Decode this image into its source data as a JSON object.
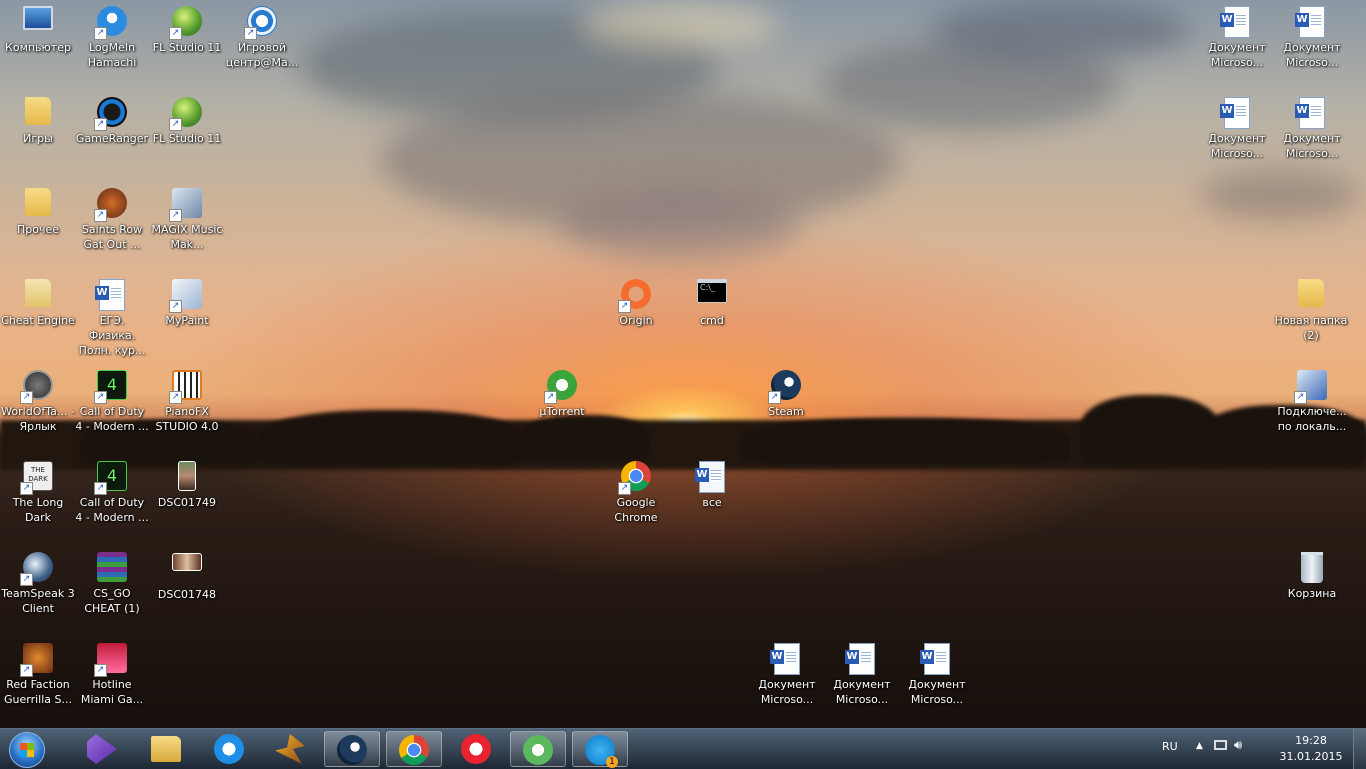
{
  "desktop_icons": {
    "computer": {
      "label": "Компьютер",
      "icon": "computer-icon"
    },
    "hamachi": {
      "label": "LogMeIn Hamachi",
      "icon": "hamachi-icon"
    },
    "fl1": {
      "label": "FL Studio 11",
      "icon": "fl-studio-icon"
    },
    "gamecenter": {
      "label": "Игровой центр@Ма...",
      "icon": "game-center-icon"
    },
    "games": {
      "label": "Игры",
      "icon": "folder-icon"
    },
    "gameranger": {
      "label": "GameRanger",
      "icon": "gameranger-icon"
    },
    "fl2": {
      "label": "FL Studio 11",
      "icon": "fl-studio-icon"
    },
    "other": {
      "label": "Прочее",
      "icon": "folder-icon"
    },
    "saintsrow": {
      "label": "Saints Row Gat Out ...",
      "icon": "saints-row-icon"
    },
    "magix": {
      "label": "MAGIX Music Mak...",
      "icon": "magix-icon"
    },
    "cheatengine": {
      "label": "Cheat Engine",
      "icon": "folder-icon"
    },
    "ege": {
      "label": "ЕГЭ. Физика. Полн. кур...",
      "icon": "word-doc-icon"
    },
    "mypaint": {
      "label": "MyPaint",
      "icon": "mypaint-icon"
    },
    "wot": {
      "label": "WorldOfTa... - Ярлык",
      "icon": "world-of-tanks-icon"
    },
    "cod1": {
      "label": "Call of Duty 4 - Modern ...",
      "icon": "call-of-duty-icon"
    },
    "pianofx": {
      "label": "PianoFX STUDIO 4.0",
      "icon": "pianofx-icon"
    },
    "longdark": {
      "label": "The Long Dark",
      "icon": "the-long-dark-icon"
    },
    "cod2": {
      "label": "Call of Duty 4 - Modern ...",
      "icon": "call-of-duty-icon"
    },
    "dsc1749": {
      "label": "DSC01749",
      "icon": "photo-icon"
    },
    "teamspeak": {
      "label": "TeamSpeak 3 Client",
      "icon": "teamspeak-icon"
    },
    "csgo": {
      "label": "CS_GO CHEAT (1)",
      "icon": "winrar-archive-icon"
    },
    "dsc1748": {
      "label": "DSC01748",
      "icon": "photo-icon"
    },
    "redfaction": {
      "label": "Red Faction Guerrilla S...",
      "icon": "red-faction-icon"
    },
    "hotline": {
      "label": "Hotline Miami Ga...",
      "icon": "hotline-miami-icon"
    },
    "origin": {
      "label": "Origin",
      "icon": "origin-icon"
    },
    "cmd": {
      "label": "cmd",
      "icon": "cmd-icon"
    },
    "utorrent": {
      "label": "µTorrent",
      "icon": "utorrent-icon"
    },
    "steam": {
      "label": "Steam",
      "icon": "steam-icon"
    },
    "chrome": {
      "label": "Google Chrome",
      "icon": "chrome-icon"
    },
    "vse": {
      "label": "все",
      "icon": "document-icon"
    },
    "doc_b1": {
      "label": "Документ Microso...",
      "icon": "word-doc-icon"
    },
    "doc_b2": {
      "label": "Документ Microso...",
      "icon": "word-doc-icon"
    },
    "doc_b3": {
      "label": "Документ Microso...",
      "icon": "word-doc-icon"
    },
    "doc_r1": {
      "label": "Документ Microso...",
      "icon": "word-doc-icon"
    },
    "doc_r2": {
      "label": "Документ Microso...",
      "icon": "word-doc-icon"
    },
    "doc_r3": {
      "label": "Документ Microso...",
      "icon": "word-doc-icon"
    },
    "doc_r4": {
      "label": "Документ Microso...",
      "icon": "word-doc-icon"
    },
    "newfolder": {
      "label": "Новая папка (2)",
      "icon": "folder-icon"
    },
    "network": {
      "label": "Подключе... по локаль...",
      "icon": "network-connection-icon"
    },
    "recycle": {
      "label": "Корзина",
      "icon": "recycle-bin-icon"
    }
  },
  "taskbar": {
    "start": "start-orb-icon",
    "pinned": [
      "visual-studio-icon",
      "explorer-icon",
      "internet-explorer-icon",
      "winamp-icon",
      "steam-icon",
      "chrome-icon",
      "yandex-browser-icon",
      "utorrent-icon",
      "skype-icon"
    ],
    "skype_badge": "1",
    "tray": {
      "language": "RU",
      "time": "19:28",
      "date": "31.01.2015"
    }
  },
  "colors": {
    "taskbar_top": "#465a6e",
    "taskbar_bottom": "#19232f",
    "sky": "#c9b39b",
    "sun": "#ffdc8c"
  }
}
